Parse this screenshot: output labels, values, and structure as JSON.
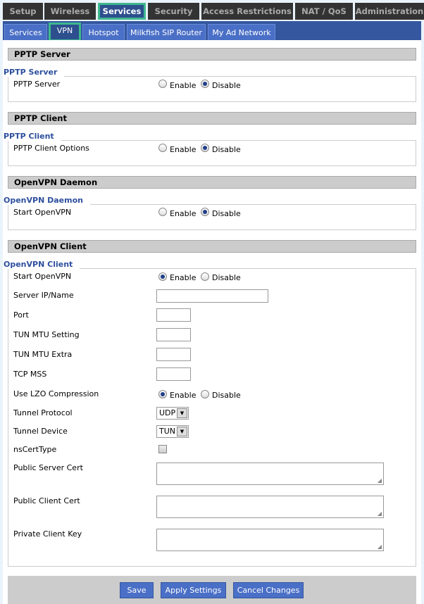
{
  "top_tabs": [
    {
      "label": "Setup"
    },
    {
      "label": "Wireless"
    },
    {
      "label": "Services",
      "active": true
    },
    {
      "label": "Security"
    },
    {
      "label": "Access Restrictions"
    },
    {
      "label": "NAT / QoS"
    },
    {
      "label": "Administration"
    }
  ],
  "sub_tabs": [
    {
      "label": "Services"
    },
    {
      "label": "VPN",
      "active": true
    },
    {
      "label": "Hotspot"
    },
    {
      "label": "Milkfish SIP Router"
    },
    {
      "label": "My Ad Network"
    }
  ],
  "radio_labels": {
    "enable": "Enable",
    "disable": "Disable"
  },
  "sections": {
    "pptp_server": {
      "header": "PPTP Server",
      "legend": "PPTP Server",
      "label": "PPTP Server",
      "value": "Disable"
    },
    "pptp_client": {
      "header": "PPTP Client",
      "legend": "PPTP Client",
      "label": "PPTP Client Options",
      "value": "Disable"
    },
    "openvpn_daemon": {
      "header": "OpenVPN Daemon",
      "legend": "OpenVPN Daemon",
      "label": "Start OpenVPN",
      "value": "Disable"
    },
    "openvpn_client": {
      "header": "OpenVPN Client",
      "legend": "OpenVPN Client",
      "start_openvpn": {
        "label": "Start OpenVPN",
        "value": "Enable"
      },
      "server_ip": {
        "label": "Server IP/Name",
        "value": ""
      },
      "port": {
        "label": "Port",
        "value": ""
      },
      "tun_mtu": {
        "label": "TUN MTU Setting",
        "value": ""
      },
      "tun_mtu_extra": {
        "label": "TUN MTU Extra",
        "value": ""
      },
      "tcp_mss": {
        "label": "TCP MSS",
        "value": ""
      },
      "lzo": {
        "label": "Use LZO Compression",
        "value": "Enable"
      },
      "tunnel_protocol": {
        "label": "Tunnel Protocol",
        "value": "UDP"
      },
      "tunnel_device": {
        "label": "Tunnel Device",
        "value": "TUN"
      },
      "nscerttype": {
        "label": "nsCertType",
        "checked": false
      },
      "public_server_cert": {
        "label": "Public Server Cert",
        "value": ""
      },
      "public_client_cert": {
        "label": "Public Client Cert",
        "value": ""
      },
      "private_client_key": {
        "label": "Private Client Key",
        "value": ""
      }
    }
  },
  "footer": {
    "save": "Save",
    "apply": "Apply Settings",
    "cancel": "Cancel Changes"
  },
  "colors": {
    "accent": "#3fb88f",
    "nav_blue": "#34579f",
    "tab_blue": "#4a6fc6",
    "legend": "#2d4f9e"
  }
}
